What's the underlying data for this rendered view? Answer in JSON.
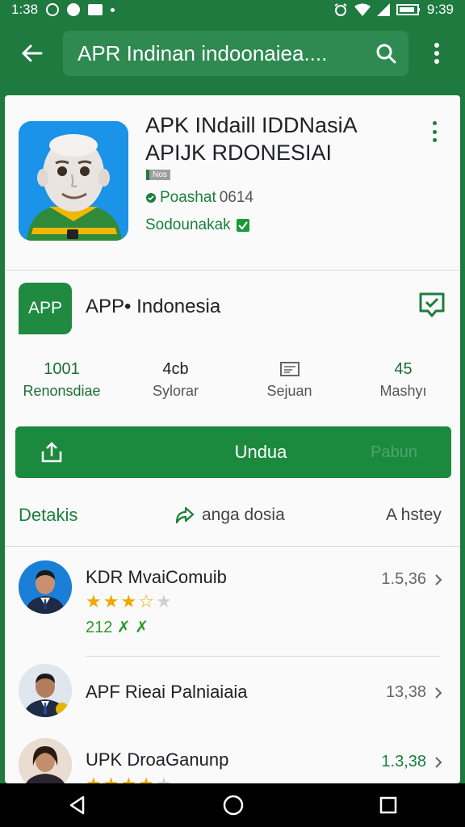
{
  "status_bar": {
    "time": "1:38",
    "time_right": "9:39"
  },
  "search": {
    "query": "APR Indinan indoonaiea...."
  },
  "app": {
    "title_line1": "APK INdaill IDDNasiA",
    "title_line2": "APIJK RDONESIAI",
    "badge": "Nos",
    "rating_text": "Poashat",
    "rating_value": "0614",
    "developer": "Sodounakak"
  },
  "app2": {
    "logo_text": "APP",
    "name": "APP• Indonesia"
  },
  "stats": [
    {
      "value": "1001",
      "label": "Renonsdiae"
    },
    {
      "value": "4cb",
      "label": "Sylorar"
    },
    {
      "value": "",
      "label": "Sejuan"
    },
    {
      "value": "45",
      "label": "Mashyı"
    }
  ],
  "install": {
    "label": "Undua",
    "ghost_label": "Pabun"
  },
  "tabs": {
    "details": "Detakis",
    "share": "anga dosia",
    "history": "A hstey"
  },
  "list": [
    {
      "title": "KDR MvaiComuib",
      "value": "1.5,36",
      "rating": 3.5,
      "sub": "212 ✗ ✗"
    },
    {
      "title": "APF Rieai Palniaiaia",
      "value": "13,38"
    },
    {
      "title": "UPK DroaGanunp",
      "value": "1.3,38"
    }
  ],
  "colors": {
    "primary": "#1f7a40",
    "accent": "#1c8a3e",
    "star": "#f2a600"
  }
}
